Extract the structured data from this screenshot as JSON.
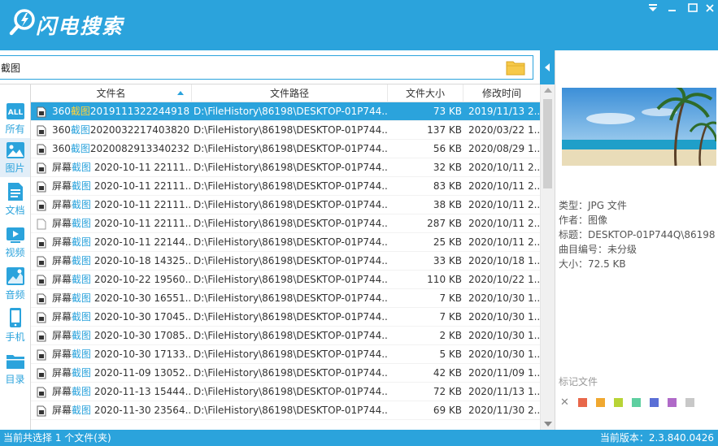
{
  "app": {
    "title": "闪电搜索"
  },
  "search": {
    "value": "截图",
    "placeholder": ""
  },
  "sidebar": {
    "items": [
      {
        "label": "所有",
        "icon": "all-icon"
      },
      {
        "label": "图片",
        "icon": "image-icon"
      },
      {
        "label": "文档",
        "icon": "document-icon"
      },
      {
        "label": "视频",
        "icon": "video-icon"
      },
      {
        "label": "音频",
        "icon": "audio-icon"
      },
      {
        "label": "手机",
        "icon": "phone-icon"
      },
      {
        "label": "目录",
        "icon": "folder-icon"
      }
    ]
  },
  "table": {
    "headers": {
      "name": "文件名",
      "path": "文件路径",
      "size": "文件大小",
      "time": "修改时间"
    },
    "rows": [
      {
        "pre": "360",
        "hl": "截图",
        "post": "2019111322244918...",
        "path": "D:\\FileHistory\\86198\\DESKTOP-01P744...",
        "size": "73 KB",
        "time": "2019/11/13 2..."
      },
      {
        "pre": "360",
        "hl": "截图",
        "post": "2020032217403820...",
        "path": "D:\\FileHistory\\86198\\DESKTOP-01P744...",
        "size": "137 KB",
        "time": "2020/03/22 1..."
      },
      {
        "pre": "360",
        "hl": "截图",
        "post": "2020082913340232...",
        "path": "D:\\FileHistory\\86198\\DESKTOP-01P744...",
        "size": "56 KB",
        "time": "2020/08/29 1..."
      },
      {
        "pre": "屏幕",
        "hl": "截图",
        "post": " 2020-10-11 22111...",
        "path": "D:\\FileHistory\\86198\\DESKTOP-01P744...",
        "size": "32 KB",
        "time": "2020/10/11 2..."
      },
      {
        "pre": "屏幕",
        "hl": "截图",
        "post": " 2020-10-11 22111...",
        "path": "D:\\FileHistory\\86198\\DESKTOP-01P744...",
        "size": "83 KB",
        "time": "2020/10/11 2..."
      },
      {
        "pre": "屏幕",
        "hl": "截图",
        "post": " 2020-10-11 22111...",
        "path": "D:\\FileHistory\\86198\\DESKTOP-01P744...",
        "size": "38 KB",
        "time": "2020/10/11 2..."
      },
      {
        "pre": "屏幕",
        "hl": "截图",
        "post": " 2020-10-11 22111...",
        "path": "D:\\FileHistory\\86198\\DESKTOP-01P744...",
        "size": "287 KB",
        "time": "2020/10/11 2..."
      },
      {
        "pre": "屏幕",
        "hl": "截图",
        "post": " 2020-10-11 22144...",
        "path": "D:\\FileHistory\\86198\\DESKTOP-01P744...",
        "size": "25 KB",
        "time": "2020/10/11 2..."
      },
      {
        "pre": "屏幕",
        "hl": "截图",
        "post": " 2020-10-18 14325...",
        "path": "D:\\FileHistory\\86198\\DESKTOP-01P744...",
        "size": "33 KB",
        "time": "2020/10/18 1..."
      },
      {
        "pre": "屏幕",
        "hl": "截图",
        "post": " 2020-10-22 19560...",
        "path": "D:\\FileHistory\\86198\\DESKTOP-01P744...",
        "size": "110 KB",
        "time": "2020/10/22 1..."
      },
      {
        "pre": "屏幕",
        "hl": "截图",
        "post": " 2020-10-30 16551...",
        "path": "D:\\FileHistory\\86198\\DESKTOP-01P744...",
        "size": "7 KB",
        "time": "2020/10/30 1..."
      },
      {
        "pre": "屏幕",
        "hl": "截图",
        "post": " 2020-10-30 17045...",
        "path": "D:\\FileHistory\\86198\\DESKTOP-01P744...",
        "size": "7 KB",
        "time": "2020/10/30 1..."
      },
      {
        "pre": "屏幕",
        "hl": "截图",
        "post": " 2020-10-30 17085...",
        "path": "D:\\FileHistory\\86198\\DESKTOP-01P744...",
        "size": "2 KB",
        "time": "2020/10/30 1..."
      },
      {
        "pre": "屏幕",
        "hl": "截图",
        "post": " 2020-10-30 17133...",
        "path": "D:\\FileHistory\\86198\\DESKTOP-01P744...",
        "size": "5 KB",
        "time": "2020/10/30 1..."
      },
      {
        "pre": "屏幕",
        "hl": "截图",
        "post": " 2020-11-09 13052...",
        "path": "D:\\FileHistory\\86198\\DESKTOP-01P744...",
        "size": "42 KB",
        "time": "2020/11/09 1..."
      },
      {
        "pre": "屏幕",
        "hl": "截图",
        "post": " 2020-11-13 15444...",
        "path": "D:\\FileHistory\\86198\\DESKTOP-01P744...",
        "size": "72 KB",
        "time": "2020/11/13 1..."
      },
      {
        "pre": "屏幕",
        "hl": "截图",
        "post": " 2020-11-30 23564...",
        "path": "D:\\FileHistory\\86198\\DESKTOP-01P744...",
        "size": "69 KB",
        "time": "2020/11/30 2..."
      }
    ]
  },
  "details": {
    "type": "类型：JPG 文件",
    "author": "作者：图像",
    "title": "标题：DESKTOP-01P744Q\\86198",
    "track": "曲目编号：未分级",
    "size": "大小：72.5 KB"
  },
  "tags": {
    "title": "标记文件",
    "colors": [
      "#e8674a",
      "#f0a830",
      "#b8d436",
      "#5ecfa0",
      "#5a6fd6",
      "#b06ac8",
      "#c8c8c8"
    ]
  },
  "status": {
    "left": "当前共选择 1 个文件(夹)",
    "right": "当前版本：2.3.840.0426"
  },
  "colors": {
    "accent": "#2ba3dc"
  }
}
